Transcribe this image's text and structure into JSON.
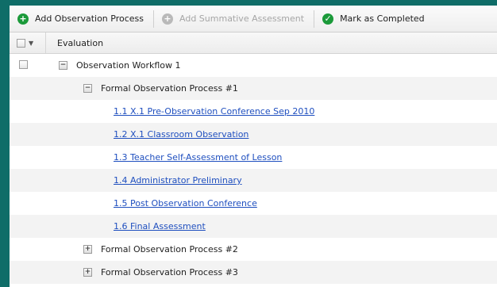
{
  "toolbar": {
    "add_observation_label": "Add Observation Process",
    "add_summative_label": "Add Summative Assessment",
    "mark_completed_label": "Mark as Completed"
  },
  "grid": {
    "header_label": "Evaluation",
    "workflow": {
      "label": "Observation Workflow 1",
      "toggle": "−",
      "processes": [
        {
          "label": "Formal Observation Process #1",
          "toggle": "−",
          "expanded": true,
          "steps": [
            "1.1 X.1 Pre-Observation Conference Sep 2010",
            "1.2 X.1 Classroom Observation",
            "1.3 Teacher Self-Assessment of Lesson",
            "1.4 Administrator Preliminary",
            "1.5 Post Observation Conference",
            "1.6 Final Assessment"
          ]
        },
        {
          "label": "Formal Observation Process #2",
          "toggle": "+",
          "expanded": false
        },
        {
          "label": "Formal Observation Process #3",
          "toggle": "+",
          "expanded": false
        }
      ]
    }
  }
}
